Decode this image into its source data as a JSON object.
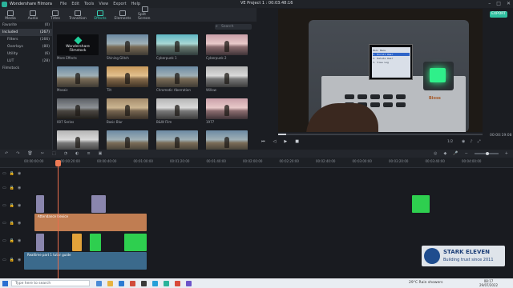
{
  "window": {
    "app_name": "Wondershare Filmora",
    "menu": [
      "File",
      "Edit",
      "Tools",
      "View",
      "Export",
      "Help"
    ],
    "project_title": "VE Project 1 : 00:03:48:16",
    "controls": [
      "–",
      "□",
      "✕"
    ]
  },
  "toolbar": {
    "tabs": [
      {
        "label": "Media",
        "icon": "media-icon"
      },
      {
        "label": "Audio",
        "icon": "audio-icon"
      },
      {
        "label": "Titles",
        "icon": "titles-icon"
      },
      {
        "label": "Transition",
        "icon": "transition-icon"
      },
      {
        "label": "Effects",
        "icon": "effects-icon",
        "active": true
      },
      {
        "label": "Elements",
        "icon": "elements-icon"
      },
      {
        "label": "Split Screen",
        "icon": "split-screen-icon"
      }
    ]
  },
  "library": {
    "items": [
      {
        "label": "Favorite",
        "count": "(0)"
      },
      {
        "label": "Included",
        "count": "(267)",
        "selected": true
      },
      {
        "label": "Filters",
        "count": "(166)",
        "sub": true
      },
      {
        "label": "Overlays",
        "count": "(80)",
        "sub": true
      },
      {
        "label": "Utility",
        "count": "(6)",
        "sub": true
      },
      {
        "label": "LUT",
        "count": "(28)",
        "sub": true
      },
      {
        "label": "Filmstock",
        "count": ""
      }
    ]
  },
  "effects": {
    "search_placeholder": "Search",
    "items": [
      {
        "label": "More Effects",
        "style": "stock",
        "stock_text_1": "Wondershare",
        "stock_text_2": "Filmstock"
      },
      {
        "label": "Shining Glitch",
        "style": "default"
      },
      {
        "label": "Cyberpunk 1",
        "style": "cyan"
      },
      {
        "label": "Cyberpunk 2",
        "style": "pink"
      },
      {
        "label": "Mosaic",
        "style": "default"
      },
      {
        "label": "Tilt",
        "style": "warm"
      },
      {
        "label": "Chromatic Aberration",
        "style": "default"
      },
      {
        "label": "Willow",
        "style": "gray"
      },
      {
        "label": "007 Series",
        "style": "dark"
      },
      {
        "label": "Basic Blur",
        "style": "sepia"
      },
      {
        "label": "B&W Film",
        "style": "gray"
      },
      {
        "label": "1977",
        "style": "pink"
      },
      {
        "label": "",
        "style": "gray"
      },
      {
        "label": "",
        "style": "default"
      },
      {
        "label": "",
        "style": "default"
      },
      {
        "label": "",
        "style": "default"
      }
    ]
  },
  "preview": {
    "export_label": "EXPORT",
    "lcd_lines": [
      "Main Menu",
      "1. Enroll User",
      "2. Delete User",
      "3. View Log"
    ],
    "brand_text": "Bioss",
    "timecode": "00:00:19:08",
    "progress_fraction": 0.04,
    "ratio_label": "1/2",
    "playback_icons": [
      "skip-back-icon",
      "play-icon",
      "stop-icon",
      "step-back-icon"
    ]
  },
  "timeline": {
    "ruler_labels": [
      "00:00:00:00",
      "00:00:20:00",
      "00:00:40:00",
      "00:01:00:00",
      "00:01:20:00",
      "00:01:40:00",
      "00:02:00:00",
      "00:02:20:00",
      "00:02:40:00",
      "00:03:00:00",
      "00:03:20:00",
      "00:03:40:00",
      "00:04:00:00"
    ],
    "playhead_label": "00:00:19:08",
    "clip_title": "Attendance Device",
    "video_label": "Realtime part 1 tutor guide"
  },
  "watermark": {
    "line1": "STARK ELEVEN",
    "line2": "Building trust since 2011"
  },
  "taskbar": {
    "search_placeholder": "Type here to search",
    "weather": "29°C  Rain showers",
    "time": "08:17",
    "date": "29/07/2022"
  },
  "colors": {
    "accent": "#37d3b6",
    "playhead": "#e96c4c",
    "audio_clip": "#c07d52",
    "green_clip": "#2ecf4f"
  }
}
